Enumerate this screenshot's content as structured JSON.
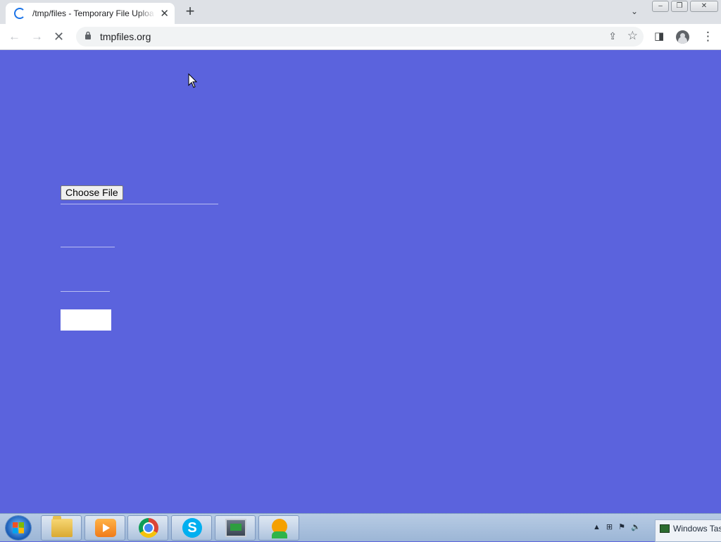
{
  "browser": {
    "tab": {
      "title": "/tmp/files - Temporary File Uploa",
      "close_glyph": "✕",
      "loading": true
    },
    "new_tab_glyph": "+",
    "tab_search_glyph": "⌄",
    "window_controls": {
      "minimize": "–",
      "restore": "❐",
      "close": "✕"
    },
    "nav": {
      "back": "←",
      "forward": "→",
      "stop": "✕"
    },
    "address": {
      "lock_icon": "lock-icon",
      "url": "tmpfiles.org"
    },
    "toolbar_icons": {
      "share": "⇪",
      "star": "☆",
      "side_panel": "◨",
      "menu": "⋮"
    }
  },
  "page": {
    "background": "#5b63dd",
    "choose_file_label": "Choose File"
  },
  "taskbar": {
    "pinned": [
      "windows-explorer",
      "media-player",
      "chrome",
      "skype",
      "network-monitor",
      "avatar-app"
    ],
    "skype_glyph": "S",
    "tray": {
      "chevron": "▲",
      "network": "⊞",
      "flag": "⚑",
      "volume": "🔈"
    },
    "preview_label": "Windows Tas"
  }
}
